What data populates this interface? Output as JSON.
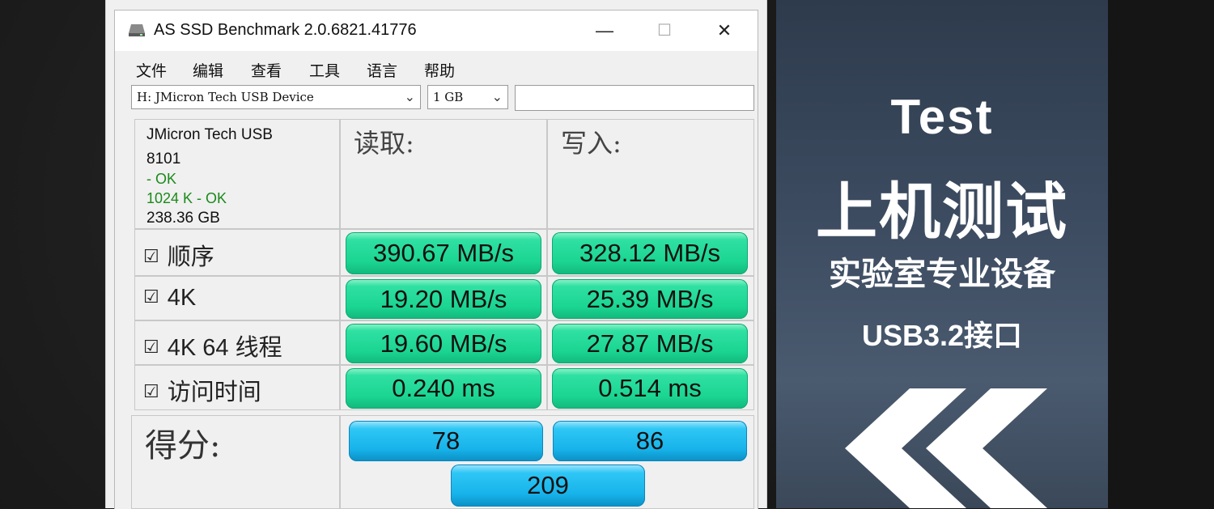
{
  "window": {
    "title": "AS SSD Benchmark 2.0.6821.41776",
    "controls": {
      "minimize": "—",
      "maximize": "☐",
      "close": "✕"
    }
  },
  "menu": [
    "文件",
    "编辑",
    "查看",
    "工具",
    "语言",
    "帮助"
  ],
  "toolbar": {
    "drive_select": "H: JMicron Tech USB Device",
    "size_select": "1 GB",
    "text_field": ""
  },
  "device_info": {
    "name": "JMicron Tech USB",
    "firmware": "8101",
    "status1": " - OK",
    "status2": "1024 K - OK",
    "capacity": "238.36 GB"
  },
  "columns": {
    "read": "读取:",
    "write": "写入:"
  },
  "rows": [
    {
      "label": "顺序",
      "checked": true,
      "read": "390.67 MB/s",
      "write": "328.12 MB/s"
    },
    {
      "label": "4K",
      "checked": true,
      "read": "19.20 MB/s",
      "write": "25.39 MB/s"
    },
    {
      "label": "4K 64 线程",
      "checked": true,
      "read": "19.60 MB/s",
      "write": "27.87 MB/s"
    },
    {
      "label": "访问时间",
      "checked": true,
      "read": "0.240 ms",
      "write": "0.514 ms"
    }
  ],
  "score": {
    "label": "得分:",
    "read": "78",
    "write": "86",
    "total": "209"
  },
  "checkbox_glyph": "☑",
  "promo": {
    "line1": "Test",
    "line2": "上机测试",
    "line3": "实验室专业设备",
    "line4": "USB3.2接口",
    "icon": "double-chevron-left-icon"
  },
  "colors": {
    "result_pill": "#1bd592",
    "score_pill": "#17b3ea",
    "ok_text": "#1a8a1a",
    "promo_bg": "#3d4c61"
  }
}
